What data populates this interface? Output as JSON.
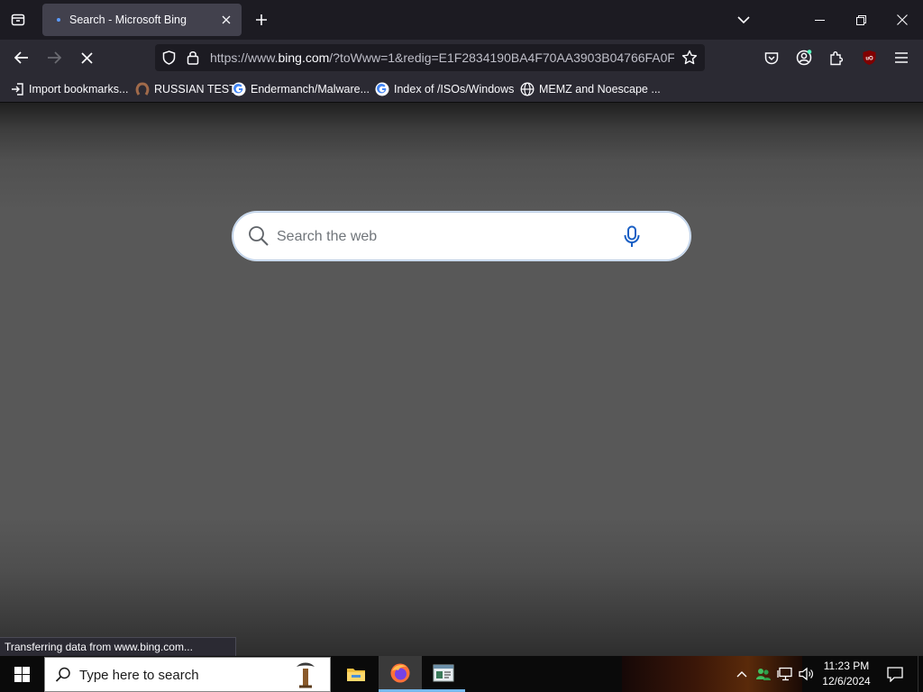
{
  "browser": {
    "tab_title": "Search - Microsoft Bing",
    "url_host_prefix": "https://www.",
    "url_host": "bing.com",
    "url_path": "/?toWww=1&redig=E1F2834190BA4F70AA3903B04766FA0F",
    "bookmarks": [
      {
        "label": "Import bookmarks...",
        "icon": "import-icon"
      },
      {
        "label": "RUSSIAN TEST",
        "icon": "horseshoe-icon"
      },
      {
        "label": "Endermanch/Malware...",
        "icon": "google-icon"
      },
      {
        "label": "Index of /ISOs/Windows",
        "icon": "google-icon"
      },
      {
        "label": "MEMZ and Noescape ...",
        "icon": "globe-icon"
      }
    ],
    "status_text": "Transferring data from www.bing.com..."
  },
  "page": {
    "search_placeholder": "Search the web"
  },
  "taskbar": {
    "search_placeholder": "Type here to search",
    "clock_time": "11:23 PM",
    "clock_date": "12/6/2024"
  },
  "colors": {
    "tabbar_bg": "#1c1b22",
    "toolbar_bg": "#2b2a33",
    "accent": "#0060df",
    "mic_blue": "#1a5fc4"
  }
}
